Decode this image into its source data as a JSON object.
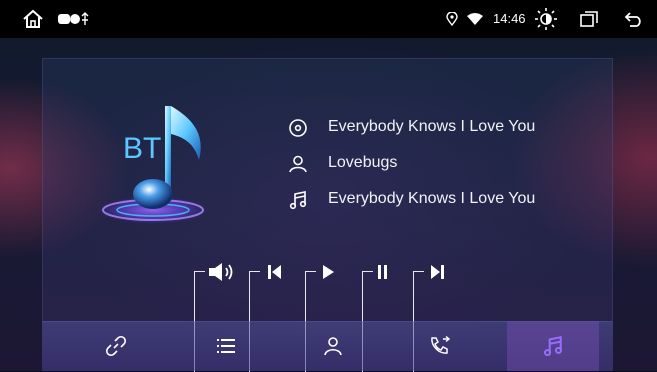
{
  "status_bar": {
    "time": "14:46",
    "icons": [
      "home-icon",
      "notification-icons",
      "location-icon",
      "wifi-icon",
      "brightness-icon",
      "recents-icon",
      "back-icon"
    ]
  },
  "player": {
    "art_label": "BT",
    "album": "Everybody Knows I Love You",
    "artist": "Lovebugs",
    "song": "Everybody Knows I Love You"
  },
  "controls": [
    "volume-icon",
    "previous-icon",
    "play-icon",
    "pause-icon",
    "next-icon"
  ],
  "nav": {
    "items": [
      "link-icon",
      "playlist-icon",
      "contacts-icon",
      "call-log-icon",
      "music-icon"
    ],
    "active": "music-icon"
  },
  "colors": {
    "accent": "#8a5cf5",
    "accent_cyan": "#3ec0f0",
    "status_bar": "#000000"
  }
}
